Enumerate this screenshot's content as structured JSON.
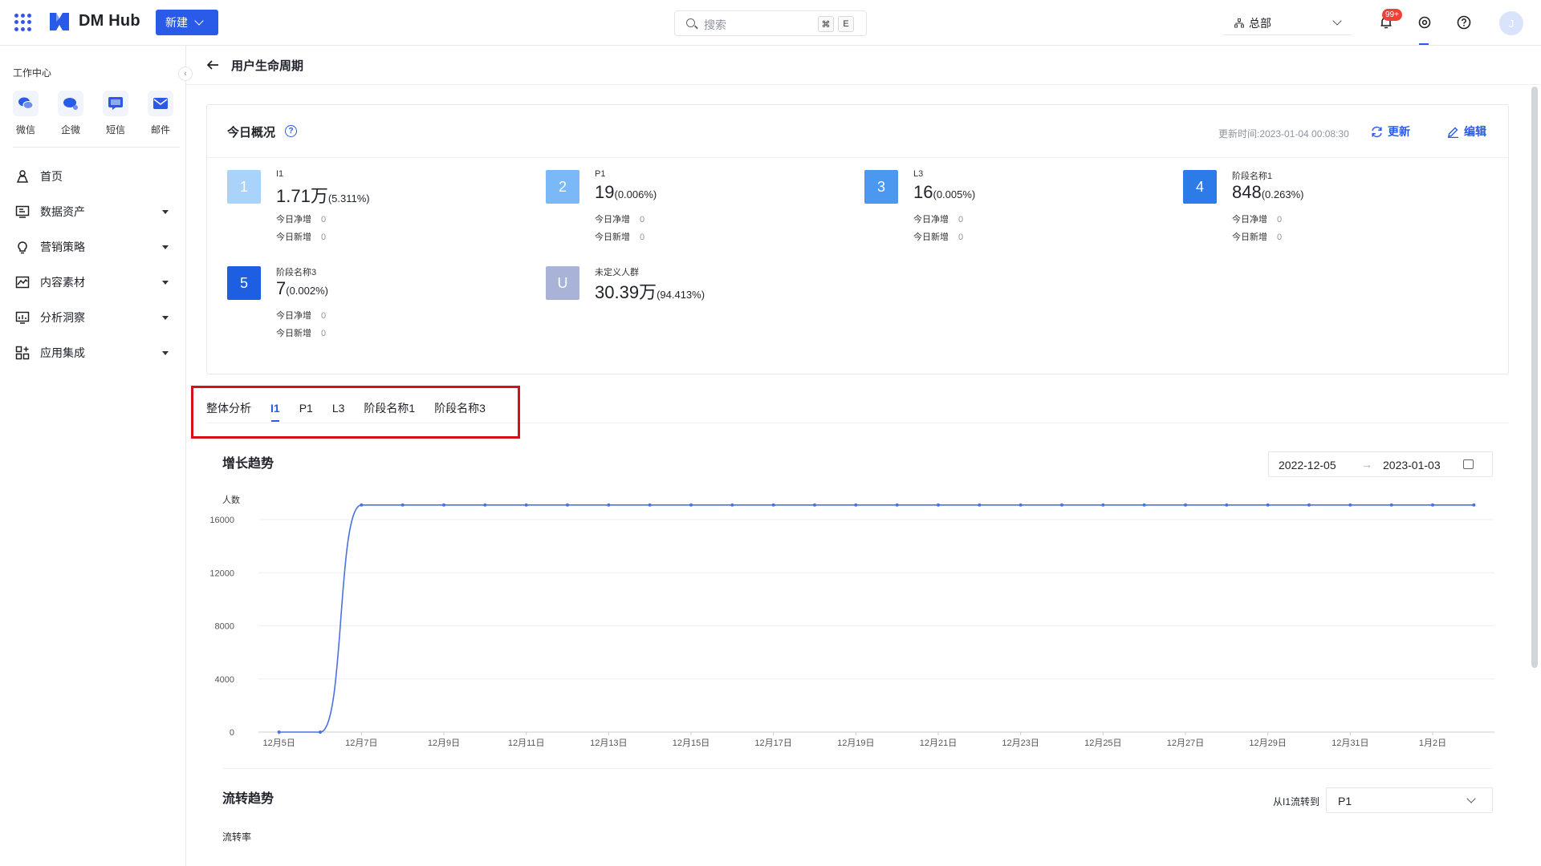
{
  "topbar": {
    "brand": "DM Hub",
    "new_button": "新建",
    "search_placeholder": "搜索",
    "shortcut_keys": [
      "⌘",
      "E"
    ],
    "org": "总部",
    "notification_badge": "99+",
    "avatar_initial": "J"
  },
  "sidebar": {
    "workspace_title": "工作中心",
    "workspace_items": [
      {
        "label": "微信",
        "icon": "wechat-icon"
      },
      {
        "label": "企微",
        "icon": "wecom-icon"
      },
      {
        "label": "短信",
        "icon": "sms-icon"
      },
      {
        "label": "邮件",
        "icon": "mail-icon"
      }
    ],
    "nav": [
      {
        "label": "首页",
        "icon": "home-icon",
        "expandable": false
      },
      {
        "label": "数据资产",
        "icon": "data-assets-icon",
        "expandable": true
      },
      {
        "label": "营销策略",
        "icon": "bulb-icon",
        "expandable": true
      },
      {
        "label": "内容素材",
        "icon": "content-icon",
        "expandable": true
      },
      {
        "label": "分析洞察",
        "icon": "analytics-icon",
        "expandable": true
      },
      {
        "label": "应用集成",
        "icon": "apps-icon",
        "expandable": true
      }
    ]
  },
  "page": {
    "title": "用户生命周期"
  },
  "overview": {
    "title": "今日概况",
    "updated": "更新时间:2023-01-04 00:08:30",
    "refresh": "更新",
    "edit": "编辑",
    "net_label": "今日净增",
    "new_label": "今日新增",
    "stages": [
      {
        "badge": "1",
        "name": "I1",
        "value": "1.71万",
        "pct": "(5.311%)",
        "net": "0",
        "new": "0",
        "color": "#a9d3fb"
      },
      {
        "badge": "2",
        "name": "P1",
        "value": "19",
        "pct": "(0.006%)",
        "net": "0",
        "new": "0",
        "color": "#7ab8f7"
      },
      {
        "badge": "3",
        "name": "L3",
        "value": "16",
        "pct": "(0.005%)",
        "net": "0",
        "new": "0",
        "color": "#4b98f1"
      },
      {
        "badge": "4",
        "name": "阶段名称1",
        "value": "848",
        "pct": "(0.263%)",
        "net": "0",
        "new": "0",
        "color": "#2c7be8"
      },
      {
        "badge": "5",
        "name": "阶段名称3",
        "value": "7",
        "pct": "(0.002%)",
        "net": "0",
        "new": "0",
        "color": "#1d5fe0"
      },
      {
        "badge": "U",
        "name": "未定义人群",
        "value": "30.39万",
        "pct": "(94.413%)",
        "color": "#a9b3d8"
      }
    ]
  },
  "tabs": [
    {
      "label": "整体分析",
      "active": false
    },
    {
      "label": "I1",
      "active": true
    },
    {
      "label": "P1",
      "active": false
    },
    {
      "label": "L3",
      "active": false
    },
    {
      "label": "阶段名称1",
      "active": false
    },
    {
      "label": "阶段名称3",
      "active": false
    }
  ],
  "growth": {
    "title": "增长趋势",
    "date_start": "2022-12-05",
    "date_end": "2023-01-03"
  },
  "chart_data": {
    "type": "line",
    "ylabel": "人数",
    "ylim": [
      0,
      16000
    ],
    "yticks": [
      0,
      4000,
      8000,
      12000,
      16000
    ],
    "x_tick_labels": [
      "12月5日",
      "12月7日",
      "12月9日",
      "12月11日",
      "12月13日",
      "12月15日",
      "12月17日",
      "12月19日",
      "12月21日",
      "12月23日",
      "12月25日",
      "12月27日",
      "12月29日",
      "12月31日",
      "1月2日"
    ],
    "x": [
      "2022-12-05",
      "2022-12-06",
      "2022-12-07",
      "2022-12-08",
      "2022-12-09",
      "2022-12-10",
      "2022-12-11",
      "2022-12-12",
      "2022-12-13",
      "2022-12-14",
      "2022-12-15",
      "2022-12-16",
      "2022-12-17",
      "2022-12-18",
      "2022-12-19",
      "2022-12-20",
      "2022-12-21",
      "2022-12-22",
      "2022-12-23",
      "2022-12-24",
      "2022-12-25",
      "2022-12-26",
      "2022-12-27",
      "2022-12-28",
      "2022-12-29",
      "2022-12-30",
      "2022-12-31",
      "2023-01-01",
      "2023-01-02",
      "2023-01-03"
    ],
    "series": [
      {
        "values": [
          0,
          0,
          17100,
          17100,
          17100,
          17100,
          17100,
          17100,
          17100,
          17100,
          17100,
          17100,
          17100,
          17100,
          17100,
          17100,
          17100,
          17100,
          17100,
          17100,
          17100,
          17100,
          17100,
          17100,
          17100,
          17100,
          17100,
          17100,
          17100,
          17100
        ]
      }
    ],
    "line_color": "#4a72e0",
    "grid": true
  },
  "flow": {
    "title": "流转趋势",
    "select_label": "从I1流转到",
    "select_value": "P1",
    "rate_label": "流转率"
  }
}
